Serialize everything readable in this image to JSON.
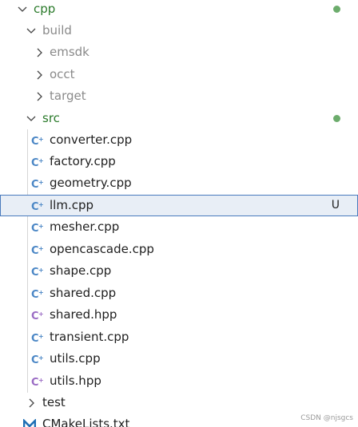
{
  "explorer": {
    "root": {
      "label": "cpp"
    },
    "build": {
      "label": "build"
    },
    "build_children": [
      {
        "label": "emsdk"
      },
      {
        "label": "occt"
      },
      {
        "label": "target"
      }
    ],
    "src": {
      "label": "src"
    },
    "src_files": [
      {
        "label": "converter.cpp",
        "type": "cpp"
      },
      {
        "label": "factory.cpp",
        "type": "cpp"
      },
      {
        "label": "geometry.cpp",
        "type": "cpp"
      },
      {
        "label": "llm.cpp",
        "type": "cpp",
        "status": "U",
        "selected": true
      },
      {
        "label": "mesher.cpp",
        "type": "cpp"
      },
      {
        "label": "opencascade.cpp",
        "type": "cpp"
      },
      {
        "label": "shape.cpp",
        "type": "cpp"
      },
      {
        "label": "shared.cpp",
        "type": "cpp"
      },
      {
        "label": "shared.hpp",
        "type": "hpp"
      },
      {
        "label": "transient.cpp",
        "type": "cpp"
      },
      {
        "label": "utils.cpp",
        "type": "cpp"
      },
      {
        "label": "utils.hpp",
        "type": "hpp"
      }
    ],
    "test": {
      "label": "test"
    },
    "cmake": {
      "label": "CMakeLists.txt"
    }
  },
  "watermark": "CSDN @njsgcs",
  "colors": {
    "modified_dot": "#6cac6c",
    "cpp_icon": "#4a86c5",
    "hpp_icon": "#9a6bc4",
    "cmake_icon": "#1f6fb5",
    "selected_border": "#4a7bbd"
  }
}
